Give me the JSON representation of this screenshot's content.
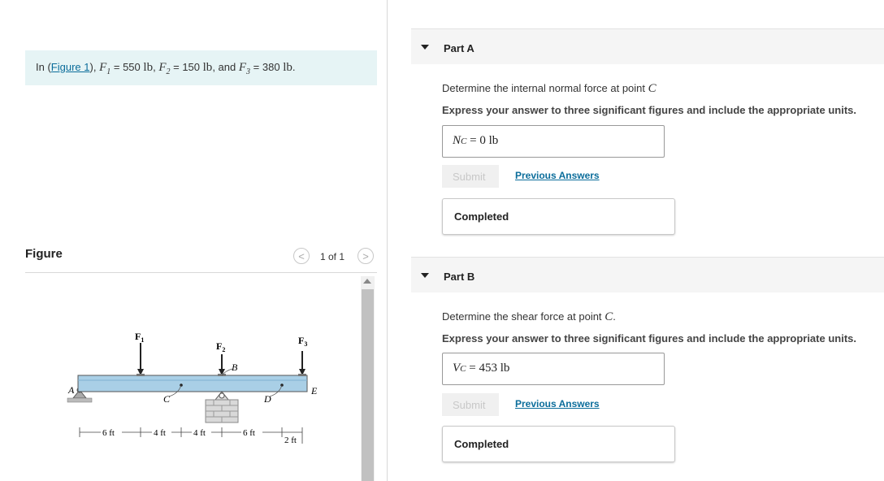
{
  "intro": {
    "prefix": "In (",
    "link": "Figure 1",
    "suffix": "),",
    "f1_label": "F",
    "f1_sub": "1",
    "f1_value": "= 550",
    "f2_label": "F",
    "f2_sub": "2",
    "f2_value": "= 150",
    "f3_label": "F",
    "f3_sub": "3",
    "f3_value": "= 380",
    "unit": "lb",
    "and": "and"
  },
  "figure": {
    "title": "Figure",
    "pager": "1 of 1",
    "prev_glyph": "<",
    "next_glyph": ">",
    "labels": {
      "A": "A",
      "B": "B",
      "C": "C",
      "D": "D",
      "E": "E",
      "F1": "F",
      "F1_sub": "1",
      "F2": "F",
      "F2_sub": "2",
      "F3": "F",
      "F3_sub": "3",
      "dim1": "6 ft",
      "dim2": "4 ft",
      "dim3": "4 ft",
      "dim4": "6 ft",
      "dim5": "2 ft"
    }
  },
  "parts": [
    {
      "title": "Part A",
      "question_prefix": "Determine the internal normal force at point",
      "question_var": "C",
      "instruction": "Express your answer to three significant figures and include the appropriate units.",
      "answer_label": "N",
      "answer_sub": "C",
      "answer_eq": "=",
      "answer_value": "0 lb",
      "submit": "Submit",
      "previous": "Previous Answers",
      "status": "Completed"
    },
    {
      "title": "Part B",
      "question_prefix": "Determine the shear force at point",
      "question_var": "C",
      "instruction": "Express your answer to three significant figures and include the appropriate units.",
      "answer_label": "V",
      "answer_sub": "C",
      "answer_eq": "=",
      "answer_value": "453 lb",
      "submit": "Submit",
      "previous": "Previous Answers",
      "status": "Completed"
    }
  ],
  "colors": {
    "link": "#0b6d9b",
    "intro_bg": "#e6f4f5",
    "beam": "#a9cfe6"
  }
}
